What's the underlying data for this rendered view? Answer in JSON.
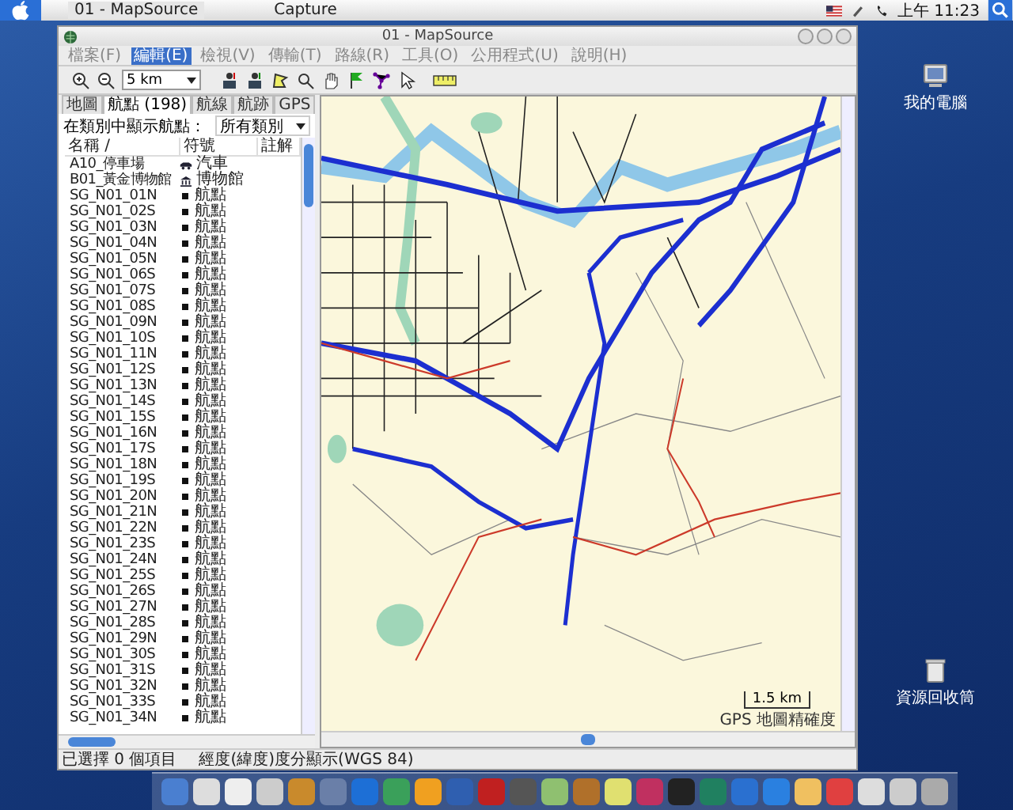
{
  "menubar": {
    "taskbar_items": [
      {
        "label": "01 - MapSource",
        "selected": true
      },
      {
        "label": "Capture",
        "selected": false
      }
    ],
    "clock": "上午 11:23"
  },
  "window": {
    "title": "01 - MapSource"
  },
  "menu": [
    {
      "label": "檔案(F)",
      "selected": false
    },
    {
      "label": "編輯(E)",
      "selected": true
    },
    {
      "label": "檢視(V)",
      "selected": false
    },
    {
      "label": "傳輸(T)",
      "selected": false
    },
    {
      "label": "路線(R)",
      "selected": false
    },
    {
      "label": "工具(O)",
      "selected": false
    },
    {
      "label": "公用程式(U)",
      "selected": false
    },
    {
      "label": "說明(H)",
      "selected": false
    }
  ],
  "toolbar": {
    "zoom_value": "5 km"
  },
  "tabs": [
    {
      "label": "地圖",
      "selected": false
    },
    {
      "label": "航點 (198)",
      "selected": true
    },
    {
      "label": "航線",
      "selected": false
    },
    {
      "label": "航跡",
      "selected": false
    },
    {
      "label": "GPS",
      "selected": false
    }
  ],
  "filter": {
    "label": "在類別中顯示航點：",
    "value": "所有類別"
  },
  "table": {
    "columns": [
      "名稱 /",
      "符號",
      "註解"
    ],
    "rows": [
      {
        "name": "A10_停車場",
        "symbol": "汽車",
        "kind": "car"
      },
      {
        "name": "B01_黃金博物館",
        "symbol": "博物館",
        "kind": "museum"
      },
      {
        "name": "SG_N01_01N",
        "symbol": "航點",
        "kind": "waypoint"
      },
      {
        "name": "SG_N01_02S",
        "symbol": "航點",
        "kind": "waypoint"
      },
      {
        "name": "SG_N01_03N",
        "symbol": "航點",
        "kind": "waypoint"
      },
      {
        "name": "SG_N01_04N",
        "symbol": "航點",
        "kind": "waypoint"
      },
      {
        "name": "SG_N01_05N",
        "symbol": "航點",
        "kind": "waypoint"
      },
      {
        "name": "SG_N01_06S",
        "symbol": "航點",
        "kind": "waypoint"
      },
      {
        "name": "SG_N01_07S",
        "symbol": "航點",
        "kind": "waypoint"
      },
      {
        "name": "SG_N01_08S",
        "symbol": "航點",
        "kind": "waypoint"
      },
      {
        "name": "SG_N01_09N",
        "symbol": "航點",
        "kind": "waypoint"
      },
      {
        "name": "SG_N01_10S",
        "symbol": "航點",
        "kind": "waypoint"
      },
      {
        "name": "SG_N01_11N",
        "symbol": "航點",
        "kind": "waypoint"
      },
      {
        "name": "SG_N01_12S",
        "symbol": "航點",
        "kind": "waypoint"
      },
      {
        "name": "SG_N01_13N",
        "symbol": "航點",
        "kind": "waypoint"
      },
      {
        "name": "SG_N01_14S",
        "symbol": "航點",
        "kind": "waypoint"
      },
      {
        "name": "SG_N01_15S",
        "symbol": "航點",
        "kind": "waypoint"
      },
      {
        "name": "SG_N01_16N",
        "symbol": "航點",
        "kind": "waypoint"
      },
      {
        "name": "SG_N01_17S",
        "symbol": "航點",
        "kind": "waypoint"
      },
      {
        "name": "SG_N01_18N",
        "symbol": "航點",
        "kind": "waypoint"
      },
      {
        "name": "SG_N01_19S",
        "symbol": "航點",
        "kind": "waypoint"
      },
      {
        "name": "SG_N01_20N",
        "symbol": "航點",
        "kind": "waypoint"
      },
      {
        "name": "SG_N01_21N",
        "symbol": "航點",
        "kind": "waypoint"
      },
      {
        "name": "SG_N01_22N",
        "symbol": "航點",
        "kind": "waypoint"
      },
      {
        "name": "SG_N01_23S",
        "symbol": "航點",
        "kind": "waypoint"
      },
      {
        "name": "SG_N01_24N",
        "symbol": "航點",
        "kind": "waypoint"
      },
      {
        "name": "SG_N01_25S",
        "symbol": "航點",
        "kind": "waypoint"
      },
      {
        "name": "SG_N01_26S",
        "symbol": "航點",
        "kind": "waypoint"
      },
      {
        "name": "SG_N01_27N",
        "symbol": "航點",
        "kind": "waypoint"
      },
      {
        "name": "SG_N01_28S",
        "symbol": "航點",
        "kind": "waypoint"
      },
      {
        "name": "SG_N01_29N",
        "symbol": "航點",
        "kind": "waypoint"
      },
      {
        "name": "SG_N01_30S",
        "symbol": "航點",
        "kind": "waypoint"
      },
      {
        "name": "SG_N01_31S",
        "symbol": "航點",
        "kind": "waypoint"
      },
      {
        "name": "SG_N01_32N",
        "symbol": "航點",
        "kind": "waypoint"
      },
      {
        "name": "SG_N01_33S",
        "symbol": "航點",
        "kind": "waypoint"
      },
      {
        "name": "SG_N01_34N",
        "symbol": "航點",
        "kind": "waypoint"
      }
    ]
  },
  "map": {
    "scale": "1.5 km",
    "accuracy": "GPS 地圖精確度"
  },
  "status_bar": [
    "已選擇 0 個項目",
    "經度(緯度)度分顯示(WGS 84)"
  ],
  "desktop_icons": [
    {
      "label": "我的電腦",
      "kind": "computer"
    },
    {
      "label": "資源回收筒",
      "kind": "trash"
    }
  ]
}
